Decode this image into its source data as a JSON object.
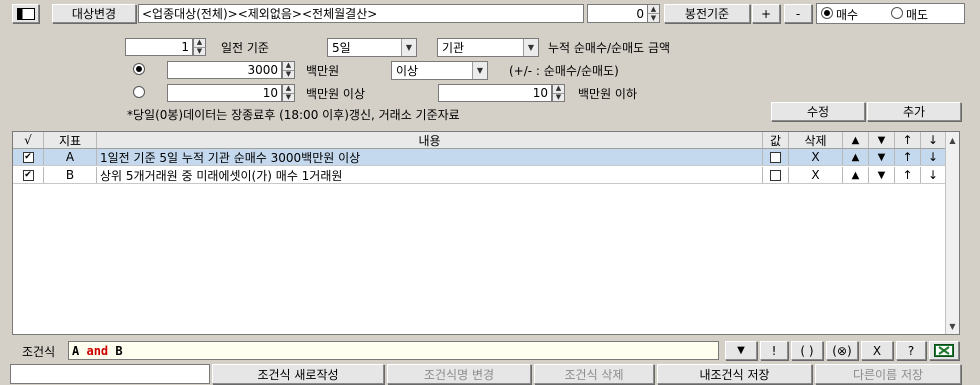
{
  "toolbar": {
    "target_change_label": "대상변경",
    "target_path": "<업종대상(전체)><제외없음><전체월결산>",
    "count_value": "0",
    "bong_label": "봉전기준",
    "plus_label": "+",
    "minus_label": "-",
    "buy_label": "매수",
    "sell_label": "매도",
    "selected_side": "buy"
  },
  "condition": {
    "days_value": "1",
    "days_suffix": "일전 기준",
    "period_value": "5일",
    "investor_value": "기관",
    "sum_label": "누적 순매수/순매도 금액",
    "amount_value": "3000",
    "amount_unit": "백만원",
    "compare_value": "이상",
    "sign_note": "(+/- : 순매수/순매도)",
    "range_from_value": "10",
    "range_from_unit": "백만원 이상",
    "range_to_value": "10",
    "range_to_unit": "백만원 이하",
    "footnote": "*당일(0봉)데이터는 장종료후 (18:00 이후)갱신, 거래소 기준자료",
    "modify_label": "수정",
    "add_label": "추가"
  },
  "grid": {
    "headers": {
      "check": "√",
      "indicator": "지표",
      "content": "내용",
      "value": "값",
      "delete": "삭제",
      "up_tri": "▲",
      "down_tri": "▼",
      "up_arrow": "↑",
      "down_arrow": "↓"
    },
    "rows": [
      {
        "id": "A",
        "content": "1일전 기준 5일 누적 기관 순매수 3000백만원 이상",
        "delete": "X",
        "up_tri": "▲",
        "down_tri": "▼",
        "up": "↑",
        "down": "↓"
      },
      {
        "id": "B",
        "content": "상위 5개거래원 중 미래에셋이(가) 매수 1거래원",
        "delete": "X",
        "up_tri": "▲",
        "down_tri": "▼",
        "up": "↑",
        "down": "↓"
      }
    ]
  },
  "expression": {
    "label": "조건식",
    "a": "A",
    "op": "and",
    "b": "B",
    "buttons": [
      "▼",
      "!",
      "( )",
      "(⊗)",
      "X",
      "?"
    ]
  },
  "footer": {
    "new_label": "조건식 새로작성",
    "rename_label": "조건식명 변경",
    "delete_label": "조건식 삭제",
    "save_label": "내조건식 저장",
    "save_as_label": "다른이름 저장"
  },
  "colors": {
    "accent_red": "#cc0000",
    "selected_row": "#c5d9ee",
    "excel_green": "#1e7a2e"
  }
}
